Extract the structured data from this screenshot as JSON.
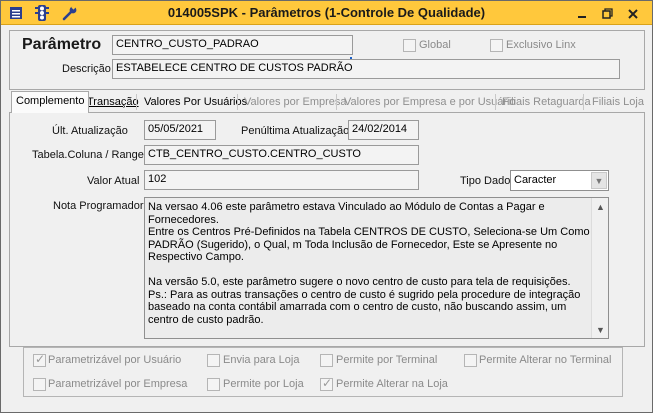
{
  "window": {
    "title": "014005SPK - Parâmetros (1-Controle De Qualidade)",
    "menu_icon": "menu-icon",
    "traffic_icon": "traffic-light-icon",
    "tools_icon": "wrench-icon",
    "minimize_label": "_",
    "restore_label": "▫",
    "close_label": "X"
  },
  "header": {
    "parametro_label": "Parâmetro",
    "parametro_value": "CENTRO_CUSTO_PADRAO",
    "descricao_label": "Descrição",
    "descricao_value": "ESTABELECE CENTRO DE CUSTOS PADRÃO",
    "global_label": "Global",
    "global_checked": false,
    "exclusivo_label": "Exclusivo Linx",
    "exclusivo_checked": false
  },
  "tabs": [
    {
      "label": "Complemento",
      "active": true,
      "enabled": true
    },
    {
      "label": "Transação",
      "active": false,
      "enabled": true
    },
    {
      "label": "Valores Por Usuários",
      "active": false,
      "enabled": true
    },
    {
      "label": "Valores por Empresa",
      "active": false,
      "enabled": false
    },
    {
      "label": "Valores por Empresa e por Usuário",
      "active": false,
      "enabled": false
    },
    {
      "label": "Filiais Retaguarda",
      "active": false,
      "enabled": false
    },
    {
      "label": "Filiais Loja",
      "active": false,
      "enabled": false
    }
  ],
  "form": {
    "ult_atualizacao_label": "Últ. Atualização",
    "ult_atualizacao_value": "05/05/2021",
    "penultima_label": "Penúltima Atualização",
    "penultima_value": "24/02/2014",
    "tabela_label": "Tabela.Coluna / Range",
    "tabela_value": "CTB_CENTRO_CUSTO.CENTRO_CUSTO",
    "valor_atual_label": "Valor Atual",
    "valor_atual_value": "102",
    "tipo_dado_label": "Tipo Dado",
    "tipo_dado_value": "Caracter",
    "nota_label": "Nota Programador",
    "nota_lines": [
      "Na versao 4.06 este parâmetro estava Vinculado ao Módulo de Contas a Pagar e",
      "Fornecedores.",
      "Entre os Centros Pré-Definidos na Tabela CENTROS DE CUSTO, Seleciona-se Um Como",
      "PADRÃO (Sugerido), o Qual, m Toda Inclusão de Fornecedor, Este se Apresente no",
      "Respectivo Campo.",
      "",
      "Na versão 5.0, este parâmetro sugere o novo centro de custo para tela de requisições.",
      "Ps.: Para as outras transações o centro de custo é sugrido pela procedure de integração",
      "baseado na conta contábil amarrada com o centro de custo, não buscando assim, um",
      "centro de custo padrão."
    ]
  },
  "options": {
    "parametrizavel_usuario": {
      "label": "Parametrizável por Usuário",
      "checked": true
    },
    "envia_loja": {
      "label": "Envia para Loja",
      "checked": false
    },
    "permite_terminal": {
      "label": "Permite por Terminal",
      "checked": false
    },
    "permite_alterar_terminal": {
      "label": "Permite Alterar no Terminal",
      "checked": false
    },
    "parametrizavel_empresa": {
      "label": "Parametrizável por Empresa",
      "checked": false
    },
    "permite_loja": {
      "label": "Permite por Loja",
      "checked": false
    },
    "permite_alterar_loja": {
      "label": "Permite Alterar na Loja",
      "checked": true
    }
  }
}
